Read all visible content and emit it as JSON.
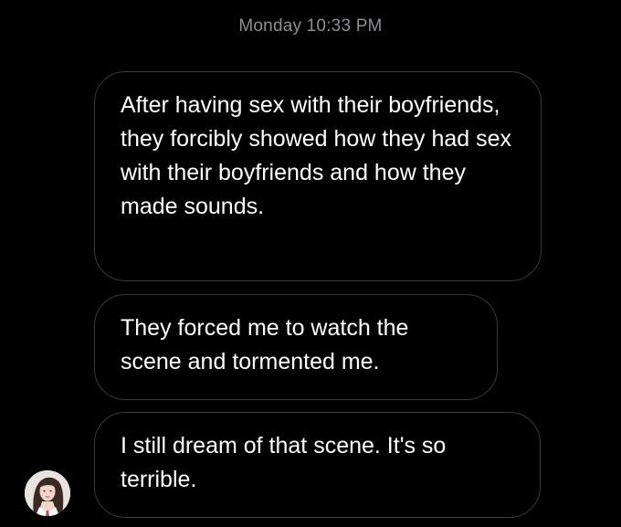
{
  "conversation": {
    "timestamp": "Monday 10:33 PM",
    "messages": [
      {
        "text": "After having sex with their boyfriends, they forcibly showed how they had sex with their boyfriends and how they made sounds."
      },
      {
        "text": "They forced me to watch the scene and tormented me."
      },
      {
        "text": "I still dream of that scene. It's so terrible."
      }
    ]
  },
  "sender": {
    "avatar": "profile-photo"
  },
  "colors": {
    "background": "#000000",
    "bubble_border": "#3a3a3c",
    "message_text": "#ffffff",
    "timestamp_text": "#8e8e93"
  }
}
